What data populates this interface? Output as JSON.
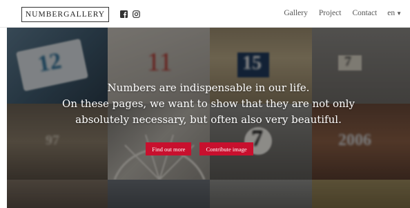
{
  "header": {
    "logo": "NUMBERGALLERY",
    "social": [
      {
        "icon": "facebook-icon"
      },
      {
        "icon": "instagram-icon"
      }
    ],
    "nav": [
      {
        "label": "Gallery"
      },
      {
        "label": "Project"
      },
      {
        "label": "Contact"
      }
    ],
    "language": {
      "label": "en",
      "icon": "chevron-down-icon"
    }
  },
  "hero": {
    "line1": "Numbers are indispensable in our life.",
    "line2": "On these pages, we want to show that they are not only",
    "line3": "absolutely necessary, but often also very beautiful.",
    "find_out_more": "Find out more",
    "contribute": "Contribute image",
    "button_color": "#c8102e"
  },
  "gallery_tiles": [
    {
      "label": "12"
    },
    {
      "label": "11"
    },
    {
      "label": "15"
    },
    {
      "label": "7"
    },
    {
      "label": "97"
    },
    {
      "label": "7"
    },
    {
      "label": "2006"
    }
  ]
}
